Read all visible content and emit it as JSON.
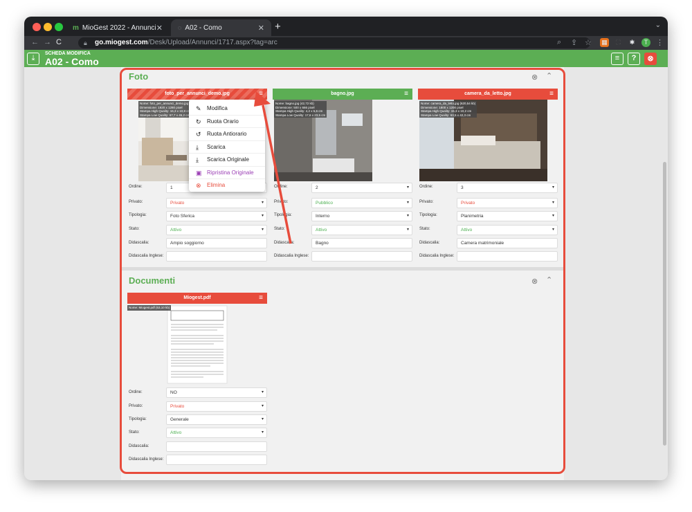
{
  "browser": {
    "tabs": [
      {
        "label": "MioGest 2022 - Annunci"
      },
      {
        "label": "A02 - Como"
      }
    ],
    "url_host": "go.miogest.com",
    "url_path": "/Desk/Upload/Annunci/1717.aspx?tag=arc",
    "profile_initial": "T"
  },
  "header": {
    "label": "SCHEDA MODIFICA",
    "title": "A02 - Como"
  },
  "foto": {
    "title": "Foto",
    "cards": [
      {
        "filename": "foto_per_annunci_demo.jpg",
        "info": "Nome: foto_per_annunci_demo.jpg\nDimensione: 1920 x 1280 pixel\nStampa High Quality: 16,3 x 10,8 cm\nStampa Low Quality: 67,7 x 45,2 cm",
        "ordine": "1",
        "privato": "Privato",
        "tipologia": "Foto Sferica",
        "stato": "Attivo",
        "didascalia": "Ampio soggiorno",
        "didascalia_inglese": ""
      },
      {
        "filename": "bagno.jpg",
        "info": "Nome: bagno.jpg (42,72 kb)\nDimensione: 500 x 666 pixel\nStampa High Quality: 4,2 x 5,6 cm\nStampa Low Quality: 17,6 x 23,5 cm",
        "ordine": "2",
        "privato": "Pubblico",
        "tipologia": "Interno",
        "stato": "Attivo",
        "didascalia": "Bagno",
        "didascalia_inglese": ""
      },
      {
        "filename": "camera_da_letto.jpg",
        "info": "Nome: camera_da_letto.jpg (620,54 kb)\nDimensione: 1800 x 1200 pixel\nStampa High Quality: 15,3 x 10,2 cm\nStampa Low Quality: 63,5 x 42,3 cm",
        "ordine": "3",
        "privato": "Privato",
        "tipologia": "Planimetria",
        "stato": "Attivo",
        "didascalia": "Camera matrimoniale",
        "didascalia_inglese": ""
      }
    ]
  },
  "labels": {
    "ordine": "Ordine:",
    "privato": "Privato:",
    "tipologia": "Tipologia:",
    "stato": "Stato:",
    "didascalia": "Didascalia:",
    "didascalia_inglese": "Didascalia Inglese:"
  },
  "menu": {
    "items": [
      {
        "label": "Modifica",
        "icon": "pencil-icon"
      },
      {
        "label": "Ruota Orario",
        "icon": "rotate-cw-icon"
      },
      {
        "label": "Ruota Antiorario",
        "icon": "rotate-ccw-icon"
      },
      {
        "label": "Scarica",
        "icon": "download-icon"
      },
      {
        "label": "Scarica Originale",
        "icon": "download-icon"
      },
      {
        "label": "Ripristina Originale",
        "icon": "image-icon"
      },
      {
        "label": "Elimina",
        "icon": "delete-icon"
      }
    ]
  },
  "documenti": {
    "title": "Documenti",
    "card": {
      "filename": "Miogest.pdf",
      "info": "Nome: Miogest.pdf (53,10 kb)",
      "ordine": "NO",
      "privato": "Privato",
      "tipologia": "Generale",
      "stato": "Attivo",
      "didascalia": "",
      "didascalia_inglese": ""
    }
  },
  "colors": {
    "green": "#5cae54",
    "red": "#e74c3c",
    "purple": "#9b3fb5"
  }
}
